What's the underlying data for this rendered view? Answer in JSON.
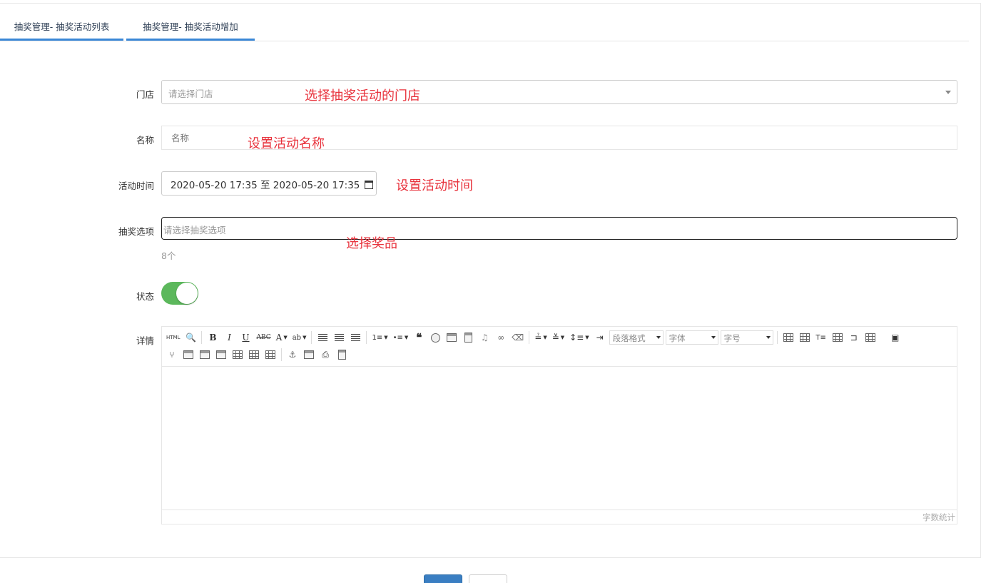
{
  "tabs": [
    {
      "label": "抽奖管理- 抽奖活动列表"
    },
    {
      "label": "抽奖管理- 抽奖活动增加"
    }
  ],
  "form": {
    "store": {
      "label": "门店",
      "placeholder": "请选择门店",
      "annotation": "选择抽奖活动的门店"
    },
    "name": {
      "label": "名称",
      "placeholder": "名称",
      "annotation": "设置活动名称"
    },
    "time": {
      "label": "活动时间",
      "value": "2020-05-20 17:35 至 2020-05-20 17:35",
      "annotation": "设置活动时间"
    },
    "prize": {
      "label": "抽奖选项",
      "placeholder": "请选择抽奖选项",
      "count": "8个",
      "annotation": "选择奖品"
    },
    "status": {
      "label": "状态",
      "on": true,
      "on_color": "#5cb85c"
    },
    "detail": {
      "label": "详情",
      "word_count": "字数统计",
      "dropdowns": {
        "paragraph": "段落格式",
        "font": "字体",
        "size": "字号"
      }
    }
  },
  "toolbar_icons": {
    "row1": [
      "html-icon",
      "preview-icon",
      "bold-icon",
      "italic-icon",
      "underline-icon",
      "strikethrough-icon",
      "font-color-icon",
      "background-color-icon",
      "align-left-icon",
      "align-center-icon",
      "align-right-icon",
      "ordered-list-icon",
      "unordered-list-icon",
      "blockquote-icon",
      "emoticon-icon",
      "image-icon",
      "video-icon",
      "music-icon",
      "link-icon",
      "eraser-icon",
      "row-spacing-top-icon",
      "row-spacing-bottom-icon",
      "line-height-icon",
      "indent-icon",
      "insert-table-icon",
      "table-properties-icon",
      "insert-title-icon",
      "insert-row-icon",
      "insert-col-icon",
      "merge-cells-icon",
      "fullscreen-icon"
    ],
    "row2": [
      "template-icon",
      "delete-table-icon",
      "insert-para-before-icon",
      "insert-para-after-icon",
      "split-cells-icon",
      "split-rows-icon",
      "split-cols-icon",
      "anchor-icon",
      "insert-frame-icon",
      "print-icon",
      "paste-plain-icon"
    ]
  },
  "colors": {
    "accent": "#3a87d6",
    "annotation": "#e8323c",
    "submit": "#3a7ec2"
  }
}
